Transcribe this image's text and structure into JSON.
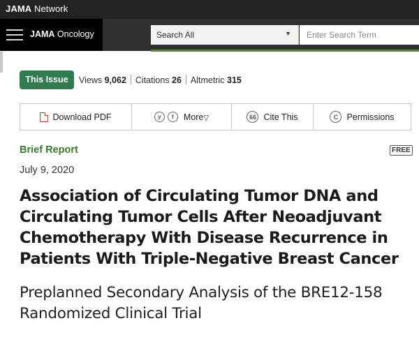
{
  "network": {
    "brand_bold": "JAMA",
    "brand_rest": " Network"
  },
  "journal": {
    "name_bold": "JAMA",
    "name_rest": " Oncology"
  },
  "search": {
    "scope": "Search All",
    "placeholder": "Enter Search Term"
  },
  "metrics": {
    "issue_label": "This Issue",
    "views_label": "Views",
    "views_value": "9,062",
    "citations_label": "Citations",
    "citations_value": "26",
    "altmetric_label": "Altmetric",
    "altmetric_value": "315"
  },
  "toolbar": {
    "download_pdf": "Download PDF",
    "more": "More",
    "cite_this": "Cite This",
    "permissions": "Permissions",
    "twitter_glyph": "y",
    "facebook_glyph": "f",
    "cite_glyph": "66",
    "copyright_glyph": "C"
  },
  "article": {
    "type": "Brief Report",
    "access": "FREE",
    "date": "July 9, 2020",
    "title": "Association of Circulating Tumor DNA and Circulating Tumor Cells After Neoadjuvant Chemotherapy With Disease Recurrence in Patients With Triple-Negative Breast Cancer",
    "subtitle": "Preplanned Secondary Analysis of the BRE12-158 Randomized Clinical Trial"
  },
  "colors": {
    "network_bar": "#222222",
    "journal_bar": "#2f2f2f",
    "accent_green": "#2f7d4f",
    "brief_green": "#3b7a2b"
  },
  "icons": [
    "menu-icon",
    "chevron-down-icon",
    "pdf-icon",
    "twitter-icon",
    "facebook-icon",
    "quote-icon",
    "copyright-icon"
  ]
}
